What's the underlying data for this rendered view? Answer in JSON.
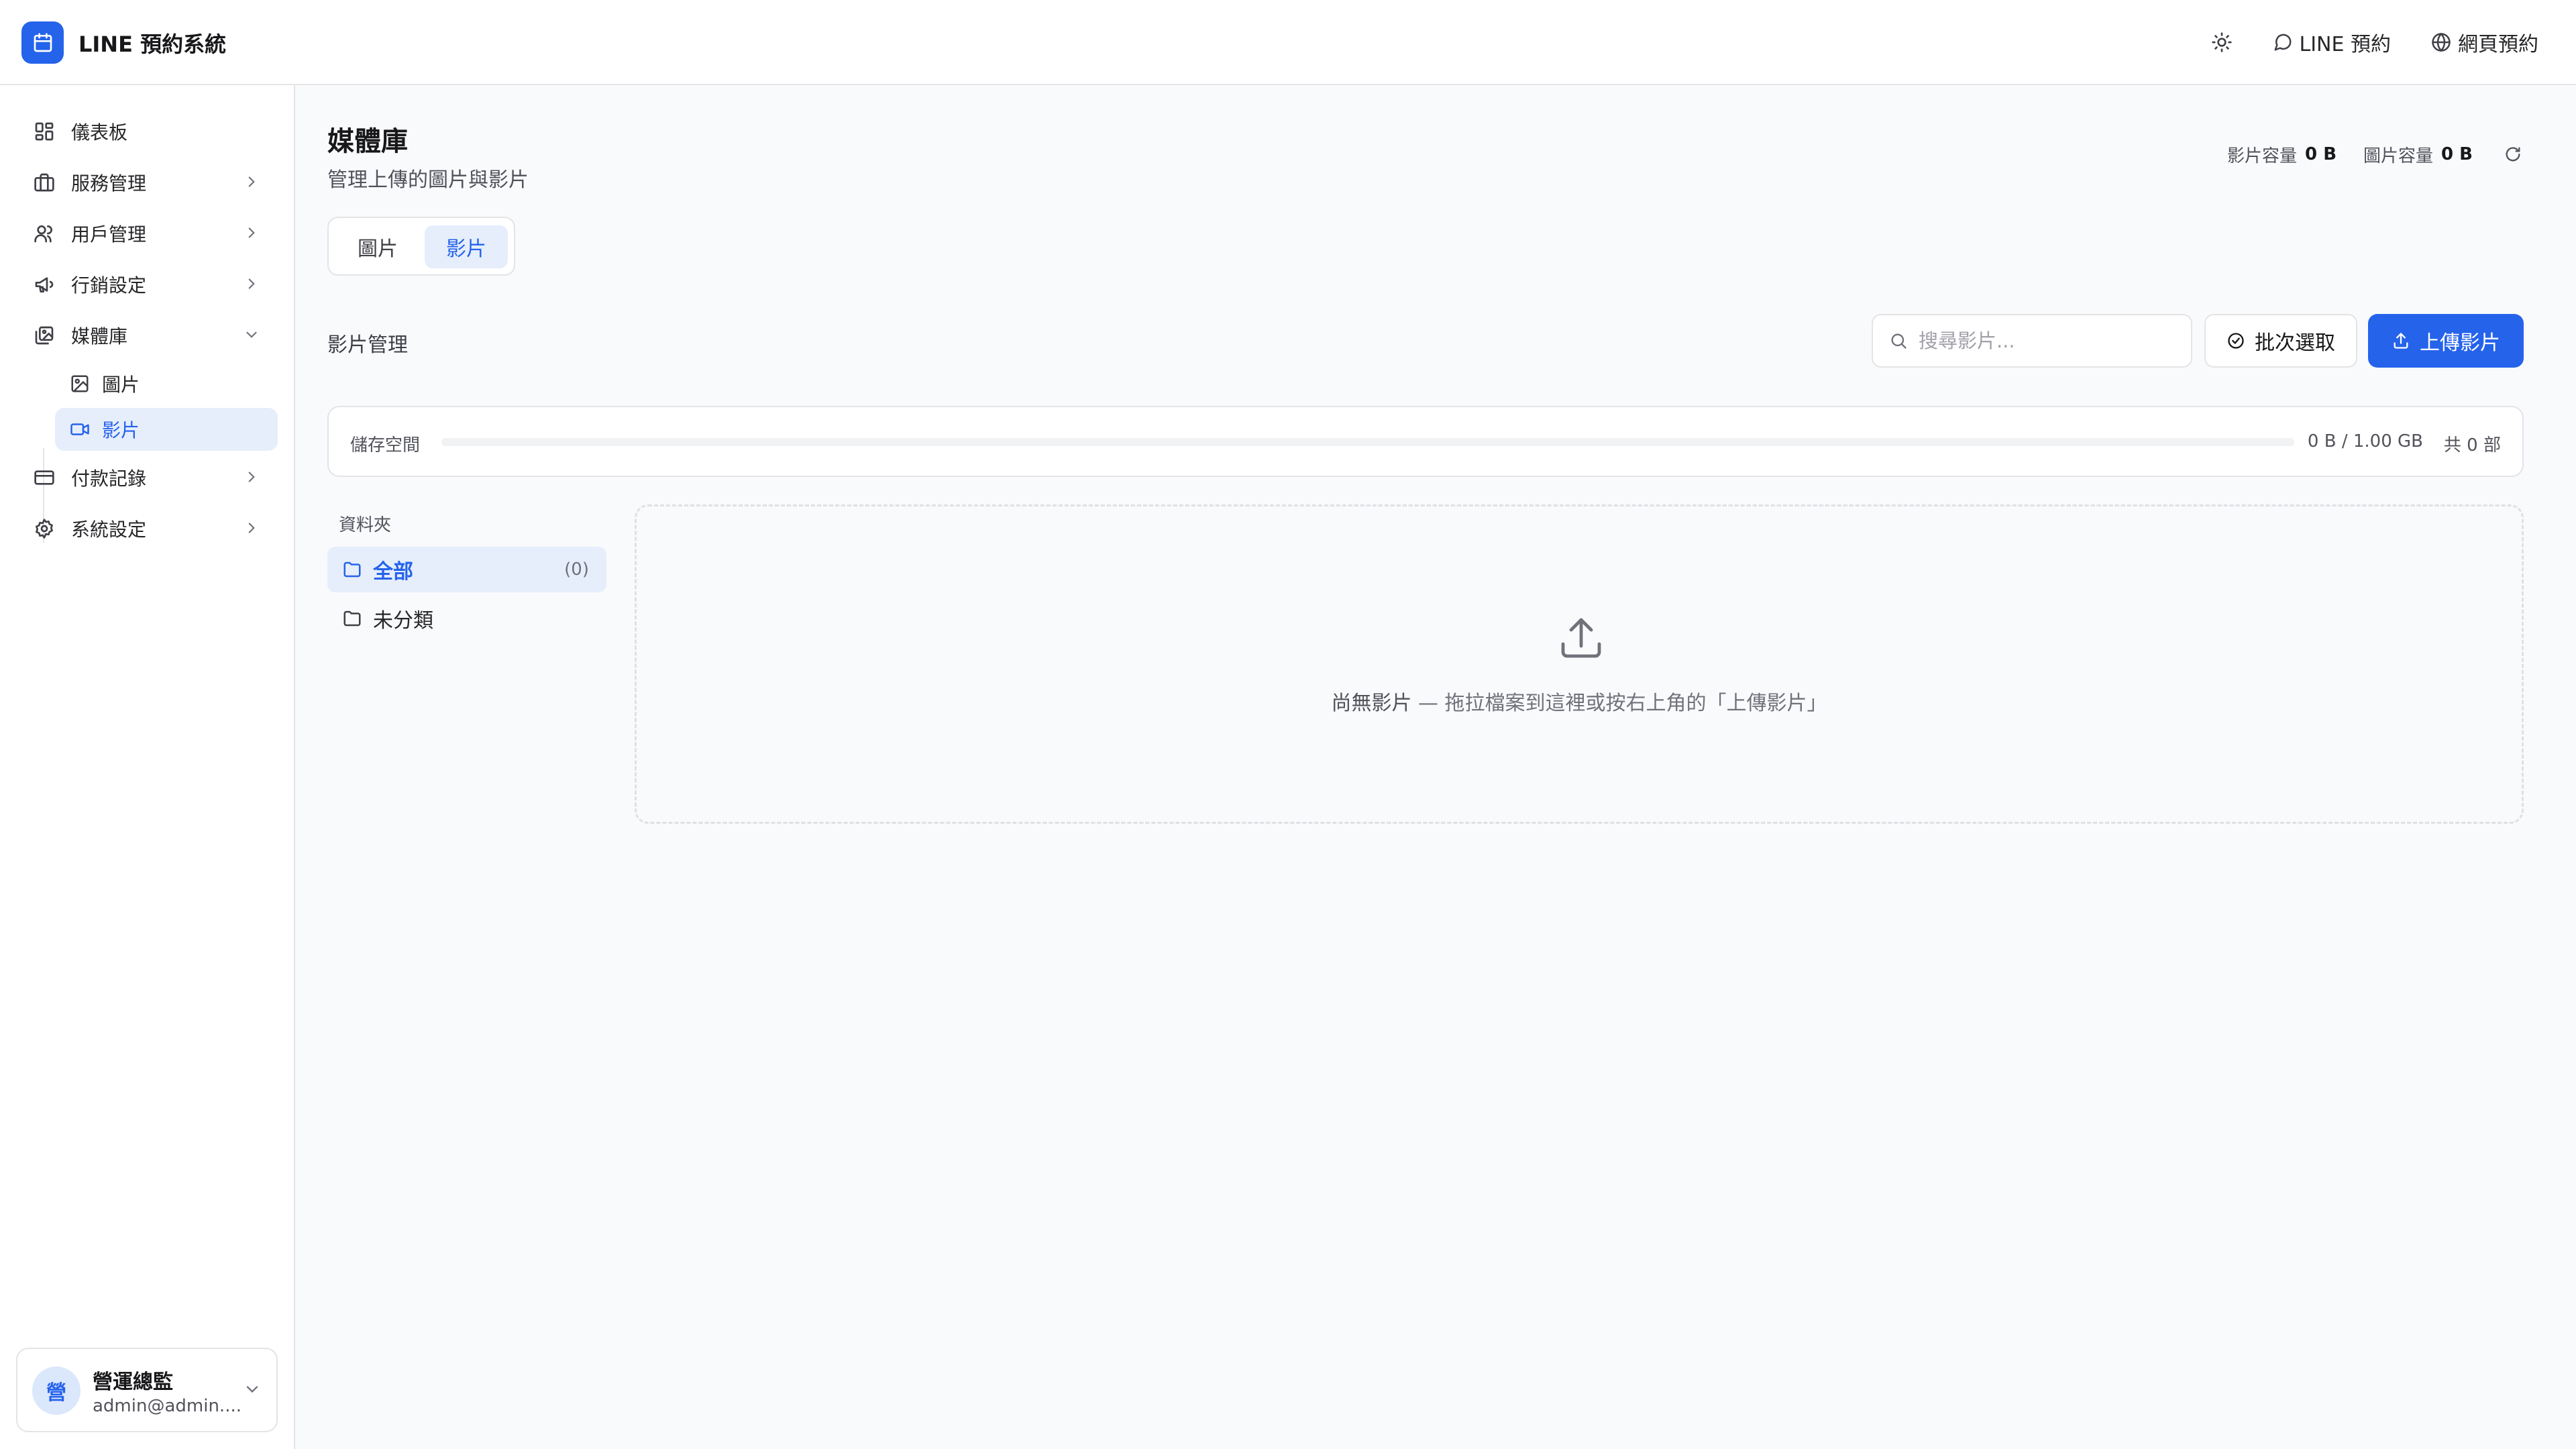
{
  "app": {
    "title": "LINE 預約系統"
  },
  "header": {
    "actions": [
      {
        "label": "LINE 預約"
      },
      {
        "label": "網頁預約"
      }
    ]
  },
  "sidebar": {
    "items": [
      {
        "label": "儀表板"
      },
      {
        "label": "服務管理"
      },
      {
        "label": "用戶管理"
      },
      {
        "label": "行銷設定"
      },
      {
        "label": "媒體庫",
        "expanded": true
      },
      {
        "label": "付款記錄"
      },
      {
        "label": "系統設定"
      }
    ],
    "media_sub": [
      {
        "label": "圖片"
      },
      {
        "label": "影片",
        "active": true
      }
    ]
  },
  "user": {
    "initial": "營",
    "name": "營運總監",
    "email": "admin@admin...."
  },
  "page": {
    "title": "媒體庫",
    "subtitle": "管理上傳的圖片與影片"
  },
  "stats": {
    "video_label": "影片容量",
    "video_value": "0 B",
    "image_label": "圖片容量",
    "image_value": "0 B"
  },
  "tabs": [
    {
      "label": "圖片"
    },
    {
      "label": "影片",
      "active": true
    }
  ],
  "section": {
    "title": "影片管理"
  },
  "search": {
    "placeholder": "搜尋影片..."
  },
  "toolbar": {
    "batch_label": "批次選取",
    "upload_label": "上傳影片"
  },
  "storage": {
    "label": "儲存空間",
    "used_text": "0 B / 1.00 GB",
    "count_text": "共 0 部",
    "used_fraction": 0
  },
  "folders": {
    "heading": "資料夾",
    "items": [
      {
        "label": "全部",
        "count": "(0)",
        "active": true
      },
      {
        "label": "未分類"
      }
    ]
  },
  "dropzone": {
    "strong": "尚無影片",
    "hint": " — 拖拉檔案到這裡或按右上角的「上傳影片」"
  },
  "colors": {
    "accent": "#2563eb",
    "accent_soft": "#e6eefc",
    "border": "#e4e4e7",
    "background": "#f8fafc"
  }
}
